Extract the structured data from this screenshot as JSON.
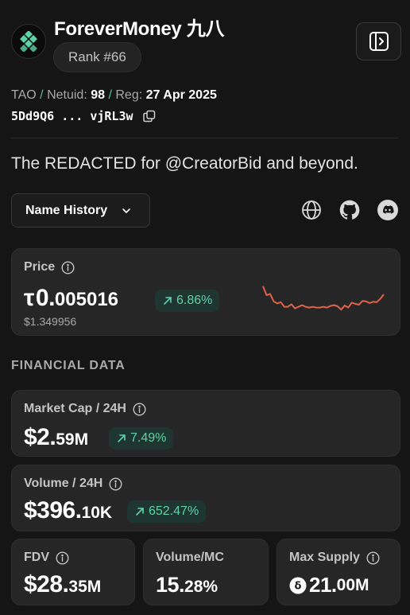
{
  "header": {
    "title": "ForeverMoney 九八",
    "rank": "Rank #66",
    "panel_icon": "sidebar-toggle-icon",
    "logo_icon": "diamond-grid-logo"
  },
  "meta": {
    "network_label": "TAO",
    "netuid_label": "Netuid:",
    "netuid_value": "98",
    "reg_label": "Reg:",
    "reg_value": "27 Apr 2025",
    "separator": "/",
    "address": "5Dd9Q6 ... vjRL3w",
    "copy_icon": "copy-icon"
  },
  "description": "The REDACTED for @CreatorBid and beyond.",
  "name_history": {
    "label": "Name History",
    "icon": "chevron-down-icon"
  },
  "socials": [
    "globe-icon",
    "github-icon",
    "discord-icon"
  ],
  "price": {
    "label": "Price",
    "symbol": "τ",
    "int": "0.",
    "dec": "005016",
    "change": "6.86%",
    "usd": "$1.349956",
    "spark": [
      0.72,
      0.5,
      0.53,
      0.35,
      0.3,
      0.33,
      0.22,
      0.22,
      0.28,
      0.18,
      0.22,
      0.26,
      0.22,
      0.2,
      0.22,
      0.2,
      0.2,
      0.22,
      0.2,
      0.24,
      0.26,
      0.23,
      0.15,
      0.25,
      0.2,
      0.32,
      0.29,
      0.27,
      0.36,
      0.35,
      0.31,
      0.34,
      0.33,
      0.41,
      0.52
    ]
  },
  "financial_title": "FINANCIAL DATA",
  "market_cap": {
    "label": "Market Cap / 24H",
    "int": "$2.",
    "dec": "59M",
    "change": "7.49%"
  },
  "volume": {
    "label": "Volume / 24H",
    "int": "$396.",
    "dec": "10K",
    "change": "652.47%"
  },
  "fdv": {
    "label": "FDV",
    "int": "$28.",
    "dec": "35M"
  },
  "volume_mc": {
    "label": "Volume/MC",
    "int": "15.",
    "dec": "28%"
  },
  "max_supply": {
    "label": "Max Supply",
    "int": "21.",
    "dec": "00M",
    "icon": "tao-coin-icon"
  },
  "colors": {
    "accent_green": "#5ed3a6",
    "badge_bg": "#1f3530",
    "spark_line": "#e0614a",
    "card_bg": "#262626",
    "page_bg": "#151515"
  }
}
